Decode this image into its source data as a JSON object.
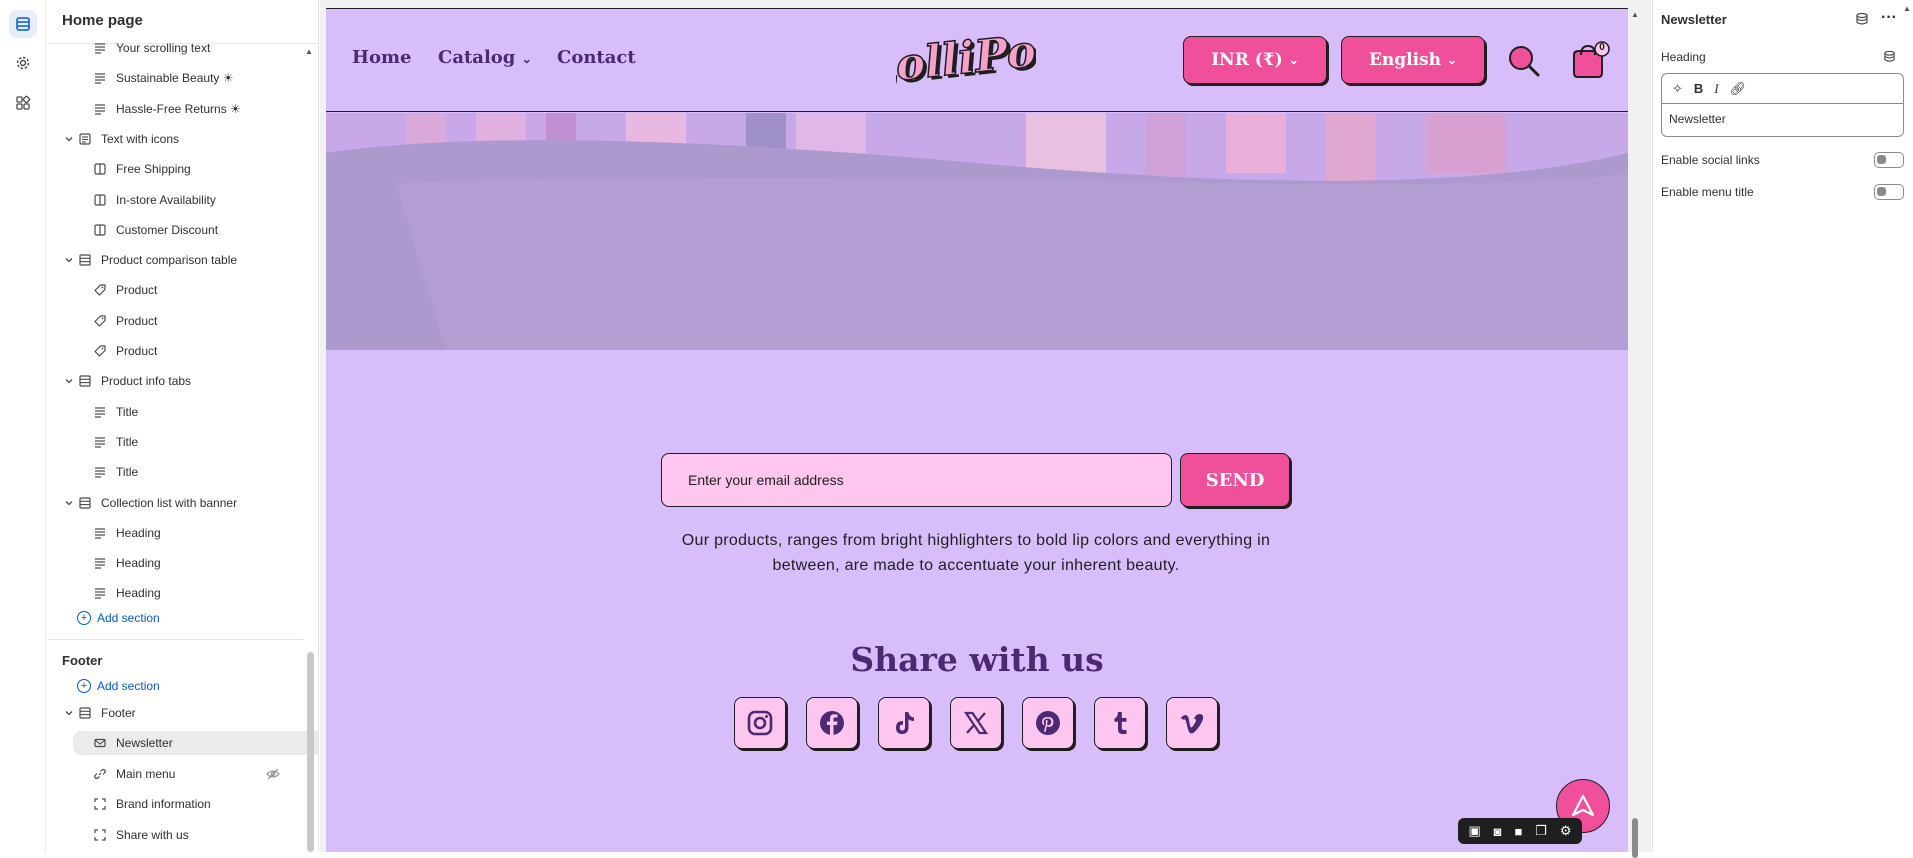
{
  "sidebar_rail": {
    "items": [
      {
        "icon": "sections-icon",
        "active": true
      },
      {
        "icon": "gear-icon",
        "active": false
      },
      {
        "icon": "apps-icon",
        "active": false
      }
    ]
  },
  "panel": {
    "title": "Home page",
    "rows": [
      {
        "label": "Your scrolling text",
        "type": "child",
        "icon": "text-icon"
      },
      {
        "label": "Sustainable Beauty ☀",
        "type": "child",
        "icon": "text-icon"
      },
      {
        "label": "Hassle-Free Returns ☀",
        "type": "child",
        "icon": "text-icon"
      },
      {
        "label": "Text with icons",
        "type": "group",
        "icon": "section-icon"
      },
      {
        "label": "Free Shipping",
        "type": "child",
        "icon": "column-icon"
      },
      {
        "label": "In-store Availability",
        "type": "child",
        "icon": "column-icon"
      },
      {
        "label": "Customer Discount",
        "type": "child",
        "icon": "column-icon"
      },
      {
        "label": "Product comparison table",
        "type": "group",
        "icon": "table-icon"
      },
      {
        "label": "Product",
        "type": "child",
        "icon": "tag-icon"
      },
      {
        "label": "Product",
        "type": "child",
        "icon": "tag-icon"
      },
      {
        "label": "Product",
        "type": "child",
        "icon": "tag-icon"
      },
      {
        "label": "Product info tabs",
        "type": "group",
        "icon": "table-icon"
      },
      {
        "label": "Title",
        "type": "child",
        "icon": "text-icon"
      },
      {
        "label": "Title",
        "type": "child",
        "icon": "text-icon"
      },
      {
        "label": "Title",
        "type": "child",
        "icon": "text-icon"
      },
      {
        "label": "Collection list with banner",
        "type": "group",
        "icon": "table-icon"
      },
      {
        "label": "Heading",
        "type": "child",
        "icon": "text-icon"
      },
      {
        "label": "Heading",
        "type": "child",
        "icon": "text-icon"
      },
      {
        "label": "Heading",
        "type": "child",
        "icon": "text-icon"
      }
    ],
    "add_section": "Add section",
    "footer_header": "Footer",
    "footer_add_section": "Add section",
    "footer_rows": [
      {
        "label": "Footer",
        "type": "group",
        "icon": "table-icon"
      },
      {
        "label": "Newsletter",
        "type": "child",
        "icon": "mail-icon",
        "selected": true
      },
      {
        "label": "Main menu",
        "type": "child",
        "icon": "link-icon",
        "hidden": true
      },
      {
        "label": "Brand information",
        "type": "child",
        "icon": "frame-icon"
      },
      {
        "label": "Share with us",
        "type": "child",
        "icon": "frame-icon"
      }
    ]
  },
  "store": {
    "nav": [
      "Home",
      "Catalog",
      "Contact"
    ],
    "logo_text": "LolliPop",
    "currency": "INR (₹)",
    "language": "English",
    "cart_count": "0",
    "email_placeholder": "Enter your email address",
    "send_label": "SEND",
    "description": "Our products, ranges from bright highlighters to bold lip colors and everything in between, are made to accentuate your inherent beauty.",
    "share_title": "Share with us",
    "socials": [
      "instagram-icon",
      "facebook-icon",
      "tiktok-icon",
      "x-icon",
      "pinterest-icon",
      "tumblr-icon",
      "vimeo-icon"
    ],
    "colors": {
      "background": "#d8bdfb",
      "accent": "#f0509a",
      "text": "#4b2a73",
      "input": "#fdc6ee"
    }
  },
  "settings": {
    "title": "Newsletter",
    "heading_label": "Heading",
    "heading_value": "Newsletter",
    "toggles": [
      {
        "label": "Enable social links",
        "on": false
      },
      {
        "label": "Enable menu title",
        "on": false
      }
    ]
  }
}
